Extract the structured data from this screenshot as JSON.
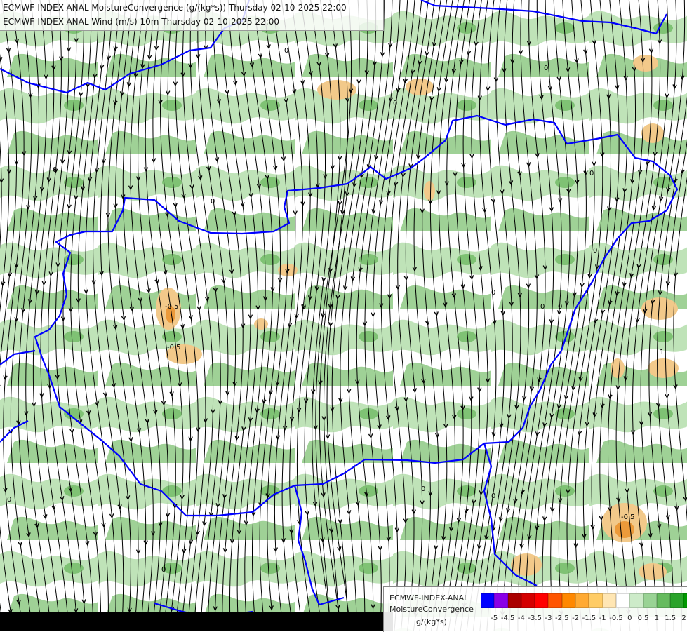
{
  "header": {
    "line1": "ECMWF-INDEX-ANAL MoistureConvergence (g/(kg*s)) Thursday 02-10-2025 22:00",
    "line2": "ECMWF-INDEX-ANAL Wind (m/s) 10m Thursday 02-10-2025 22:00"
  },
  "legend": {
    "model": "ECMWF-INDEX-ANAL",
    "parameter": "MoistureConvergence",
    "unit": "g/(kg*s)",
    "colors": [
      "#0000ff",
      "#8a00e6",
      "#aa0000",
      "#d40000",
      "#ff0000",
      "#ff5500",
      "#ff8800",
      "#ffaa33",
      "#ffcc66",
      "#ffe6b3",
      "#ffffff",
      "#cdebc9",
      "#99d394",
      "#66bb5e",
      "#2aa32a",
      "#009900"
    ],
    "ticks": [
      "-5",
      "-4.5",
      "-4",
      "-3.5",
      "-3",
      "-2.5",
      "-2",
      "-1.5",
      "-1",
      "-0.5",
      "0",
      "0.5",
      "1",
      "1.5",
      "2"
    ]
  },
  "map": {
    "contour_labels": [
      "0",
      "0",
      "0",
      "0",
      "0",
      "0",
      "0",
      "0",
      "0",
      "0",
      "0",
      "0",
      "0",
      "0",
      "0",
      "-0.5",
      "-0.5",
      "-0.5",
      "1"
    ],
    "colors": {
      "border": "#0000ff",
      "positive_fill": "#aed9a8",
      "negative_fill": "#f2c98a",
      "streamline": "#000000"
    }
  }
}
